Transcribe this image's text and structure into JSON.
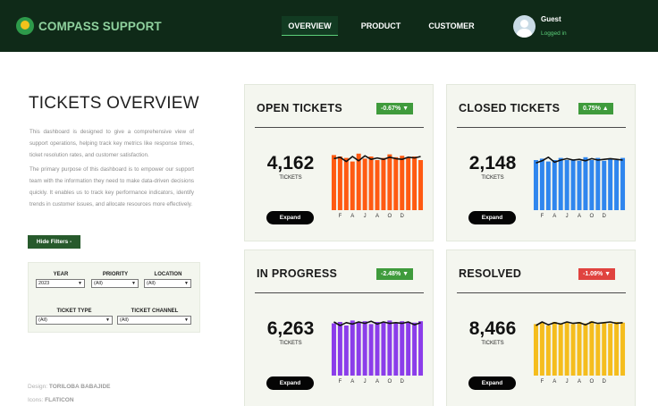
{
  "header": {
    "brand": "COMPASS SUPPORT",
    "nav": [
      {
        "label": "OVERVIEW",
        "active": true
      },
      {
        "label": "PRODUCT",
        "active": false
      },
      {
        "label": "CUSTOMER",
        "active": false
      }
    ],
    "user": {
      "name": "Guest",
      "status": "Logged in"
    }
  },
  "page": {
    "title": "TICKETS OVERVIEW",
    "desc1": "This dashboard is designed to give a comprehensive view of support operations, helping track key metrics like response times, ticket resolution rates, and customer satisfaction.",
    "desc2": "The primary purpose of this dashboard is to empower our support team with the information they need to make data-driven decisions quickly. It enables us to track key performance indicators, identify trends in customer issues, and allocate resources more effectively."
  },
  "filters": {
    "toggle_label": "Hide Filters -",
    "year": {
      "label": "YEAR",
      "value": "2023"
    },
    "priority": {
      "label": "PRIORITY",
      "value": "(All)"
    },
    "location": {
      "label": "LOCATION",
      "value": "(All)"
    },
    "ticket_type": {
      "label": "TICKET TYPE",
      "value": "(All)"
    },
    "ticket_channel": {
      "label": "TICKET CHANNEL",
      "value": "(All)"
    }
  },
  "credits": {
    "design_label": "Design:",
    "design_value": "TORILOBA BABAJIDE",
    "icons_label": "Icons:",
    "icons_value": "FLATICON"
  },
  "month_labels": [
    "F",
    "A",
    "J",
    "A",
    "O",
    "D"
  ],
  "expand_label": "Expand",
  "metric_unit": "TICKETS",
  "cards": [
    {
      "key": "open",
      "title": "OPEN TICKETS",
      "value": "4,162",
      "change": "-0.67% ▼",
      "direction": "down",
      "badge_color": "#3f9b3c",
      "bar_color": "#ff5a12",
      "bars": [
        77,
        75,
        73,
        68,
        79,
        72,
        75,
        70,
        73,
        78,
        74,
        76,
        73,
        75,
        70
      ],
      "line": [
        72,
        74,
        68,
        75,
        69,
        76,
        71,
        73,
        71,
        74,
        72,
        71,
        74,
        73,
        75
      ]
    },
    {
      "key": "closed",
      "title": "CLOSED TICKETS",
      "value": "2,148",
      "change": "0.75% ▲",
      "direction": "up",
      "badge_color": "#3f9b3c",
      "bar_color": "#2f86ee",
      "bars": [
        70,
        72,
        68,
        70,
        73,
        70,
        71,
        69,
        74,
        70,
        73,
        69,
        72,
        70,
        73
      ],
      "line": [
        66,
        69,
        74,
        67,
        70,
        72,
        70,
        71,
        69,
        72,
        70,
        71,
        72,
        71,
        70
      ]
    },
    {
      "key": "in_progress",
      "title": "IN PROGRESS",
      "value": "6,263",
      "change": "-2.48% ▼",
      "direction": "down",
      "badge_color": "#3f9b3c",
      "bar_color": "#8b3dea",
      "bars": [
        73,
        75,
        70,
        77,
        75,
        76,
        72,
        75,
        74,
        77,
        73,
        76,
        75,
        74,
        76
      ],
      "line": [
        75,
        70,
        74,
        72,
        75,
        73,
        76,
        72,
        75,
        73,
        74,
        73,
        75,
        71,
        74
      ]
    },
    {
      "key": "resolved",
      "title": "RESOLVED",
      "value": "8,466",
      "change": "-1.09% ▼",
      "direction": "down",
      "badge_color": "#e0433f",
      "bar_color": "#f5bd1d",
      "bars": [
        72,
        74,
        70,
        75,
        73,
        74,
        72,
        75,
        73,
        76,
        72,
        74,
        73,
        75,
        74
      ],
      "line": [
        70,
        75,
        71,
        74,
        72,
        75,
        73,
        74,
        71,
        75,
        73,
        74,
        75,
        73,
        74
      ]
    }
  ]
}
